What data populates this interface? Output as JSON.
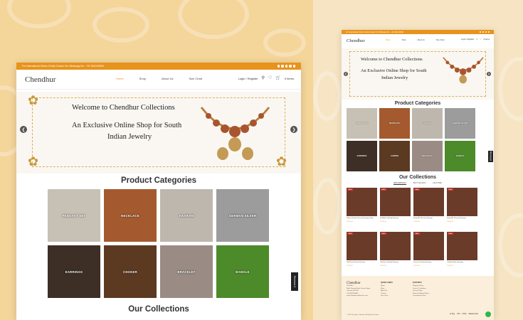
{
  "desktop": {
    "topbar_text": "For International Orders Kindly Contact Our Whatsapp No - +91 9941130904",
    "logo": "Chendhur",
    "menu": [
      {
        "label": "Home",
        "active": true
      },
      {
        "label": "Shop",
        "active": false
      },
      {
        "label": "About Us",
        "active": false
      },
      {
        "label": "Size Chart",
        "active": false
      }
    ],
    "login": "Login / Register",
    "cart_label": "0 Items",
    "hero": {
      "line1": "Welcome to Chendhur Collections",
      "line2": "An Exclusive Online Shop for South",
      "line3": "Indian Jewelry"
    },
    "categories_title": "Product Categories",
    "categories": [
      {
        "label": "PENDANT SET",
        "color": "#c7c1b5"
      },
      {
        "label": "NECKLACE",
        "color": "#a45a2e"
      },
      {
        "label": "HAARAM",
        "color": "#bdb7ae"
      },
      {
        "label": "GERMAN SILVER",
        "color": "#9c9c9c"
      },
      {
        "label": "EARRINGS",
        "color": "#3d2f26"
      },
      {
        "label": "CHOKER",
        "color": "#5c3a22"
      },
      {
        "label": "BRACELET",
        "color": "#9a8c85"
      },
      {
        "label": "BANGLE",
        "color": "#4d8a2a"
      }
    ],
    "collections_title": "Our Collections",
    "side_tab": "Reviews",
    "side_tab_count": "3"
  },
  "mobile": {
    "topbar_text": "For International Orders Kindly Contact Our Whatsapp No - +91 9941130904",
    "logo": "Chendhur",
    "menu": [
      {
        "label": "Home",
        "active": true
      },
      {
        "label": "Shop",
        "active": false
      },
      {
        "label": "About Us",
        "active": false
      },
      {
        "label": "Size Chart",
        "active": false
      }
    ],
    "login": "Login / Register",
    "cart_label": "0 Items",
    "hero": {
      "line1": "Welcome to Chendhur Collections",
      "line2": "An Exclusive Online Shop for South",
      "line3": "Indian Jewelry"
    },
    "categories_title": "Product Categories",
    "categories": [
      {
        "label": "PENDANT SET",
        "color": "#c7c1b5"
      },
      {
        "label": "NECKLACE",
        "color": "#a45a2e"
      },
      {
        "label": "HAARAM",
        "color": "#bdb7ae"
      },
      {
        "label": "GERMAN SILVER",
        "color": "#9c9c9c"
      },
      {
        "label": "EARRINGS",
        "color": "#3d2f26"
      },
      {
        "label": "CHOKER",
        "color": "#5c3a22"
      },
      {
        "label": "BRACELET",
        "color": "#9a8c85"
      },
      {
        "label": "BANGLE",
        "color": "#4d8a2a"
      }
    ],
    "collections_title": "Our Collections",
    "tabs": [
      {
        "label": "NEW ARRIVALS",
        "active": true
      },
      {
        "label": "BEST SELLERS",
        "active": false
      },
      {
        "label": "FEATURED",
        "active": false
      }
    ],
    "products": [
      {
        "name": "Pinkey Jhumki Peacock Earrings Silver",
        "price": "₹ 650.00"
      },
      {
        "name": "Studded Oxidized Earrings",
        "price": "₹ 450.00"
      },
      {
        "name": "Kemp AD Peacock Earrings",
        "price": "₹ 650.00"
      },
      {
        "name": "Kemp AD Peacock Earrings",
        "price": "₹ 650.00"
      },
      {
        "name": "Gold Toned Stone Earrings",
        "price": "₹ 450.00"
      },
      {
        "name": "Lakshmi Oxidized Earrings",
        "price": "₹ 450.00"
      },
      {
        "name": "Peacock Jhumka Earrings",
        "price": "₹ 450.00"
      },
      {
        "name": "Oxidized Silver Earrings",
        "price": "₹ 450.00"
      }
    ],
    "footer": {
      "logo": "Chendhur",
      "address": [
        "Chendhur",
        "Nothi Shenoy Road, Sriram Nagar,",
        "Chennai 600 034",
        "+91 9941130904",
        "info@chendhurcollections.com"
      ],
      "col2_title": "QUICK LINKS",
      "col2": [
        "Home",
        "Shop",
        "About Us",
        "Contact",
        "Size Chart"
      ],
      "col3_title": "OUR INFO",
      "col3": [
        "Shipping Policy",
        "Terms & Conditions",
        "Privacy Policy",
        "Return & Refund Policy",
        "Cancellation Policy"
      ],
      "copyright": "© 2023 Chendhur Collections. All Rights Reserved.",
      "payments": [
        "G Pay",
        "UPI",
        "VISA",
        "MasterCard"
      ]
    }
  }
}
